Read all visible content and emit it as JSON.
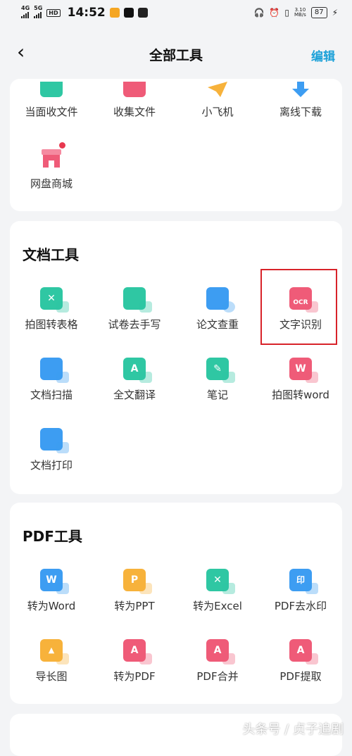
{
  "status_bar": {
    "net1": "4G",
    "net2": "5G",
    "hd": "HD",
    "time": "14:52",
    "speed": "3.10\nMB/s",
    "battery": "87"
  },
  "nav": {
    "title": "全部工具",
    "edit_label": "编辑"
  },
  "transfer_section": {
    "tools": [
      {
        "label": "当面收文件",
        "icon": "receive-file-icon",
        "color": "#2fc7a3"
      },
      {
        "label": "收集文件",
        "icon": "collect-file-icon",
        "color": "#ef5b78"
      },
      {
        "label": "小飞机",
        "icon": "paper-plane-icon",
        "color": "#f7b23b"
      },
      {
        "label": "离线下载",
        "icon": "download-icon",
        "color": "#3d9df2"
      },
      {
        "label": "网盘商城",
        "icon": "store-icon",
        "color": "#ef5b78"
      }
    ]
  },
  "doc_section": {
    "title": "文档工具",
    "tools": [
      {
        "label": "拍图转表格",
        "icon": "photo-to-table-icon",
        "color": "#2fc7a3",
        "glyph": "✕"
      },
      {
        "label": "试卷去手写",
        "icon": "remove-handwriting-icon",
        "color": "#2fc7a3",
        "glyph": ""
      },
      {
        "label": "论文查重",
        "icon": "paper-check-icon",
        "color": "#3d9df2",
        "glyph": ""
      },
      {
        "label": "文字识别",
        "icon": "ocr-icon",
        "color": "#ef5b78",
        "glyph": "OCR"
      },
      {
        "label": "文档扫描",
        "icon": "doc-scan-icon",
        "color": "#3d9df2",
        "glyph": ""
      },
      {
        "label": "全文翻译",
        "icon": "translate-icon",
        "color": "#2fc7a3",
        "glyph": "A"
      },
      {
        "label": "笔记",
        "icon": "note-icon",
        "color": "#2fc7a3",
        "glyph": "✎"
      },
      {
        "label": "拍图转word",
        "icon": "photo-to-word-icon",
        "color": "#ef5b78",
        "glyph": "W"
      },
      {
        "label": "文档打印",
        "icon": "printer-icon",
        "color": "#3d9df2",
        "glyph": ""
      }
    ]
  },
  "pdf_section": {
    "title": "PDF工具",
    "tools": [
      {
        "label": "转为Word",
        "icon": "to-word-icon",
        "color": "#3d9df2",
        "glyph": "W"
      },
      {
        "label": "转为PPT",
        "icon": "to-ppt-icon",
        "color": "#f7b23b",
        "glyph": "P"
      },
      {
        "label": "转为Excel",
        "icon": "to-excel-icon",
        "color": "#2fc7a3",
        "glyph": "✕"
      },
      {
        "label": "PDF去水印",
        "icon": "remove-watermark-icon",
        "color": "#3d9df2",
        "glyph": "印"
      },
      {
        "label": "导长图",
        "icon": "long-image-icon",
        "color": "#f7b23b",
        "glyph": "▲"
      },
      {
        "label": "转为PDF",
        "icon": "to-pdf-icon",
        "color": "#ef5b78",
        "glyph": "A"
      },
      {
        "label": "PDF合并",
        "icon": "pdf-merge-icon",
        "color": "#ef5b78",
        "glyph": "A"
      },
      {
        "label": "PDF提取",
        "icon": "pdf-extract-icon",
        "color": "#ef5b78",
        "glyph": "A"
      }
    ]
  },
  "watermark": "头条号 / 贞子追剧"
}
